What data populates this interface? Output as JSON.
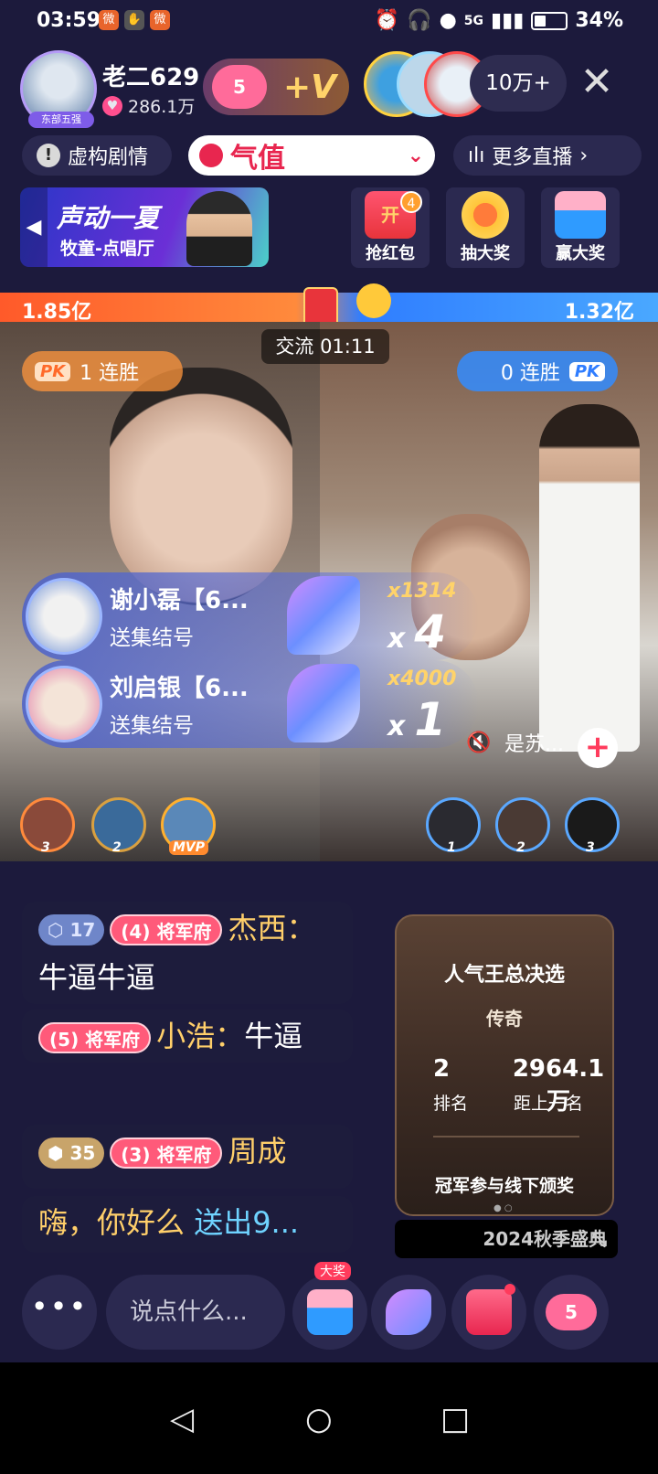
{
  "status_bar": {
    "time": "03:59",
    "battery": "34%",
    "network": "5G"
  },
  "host": {
    "name": "老二629",
    "fans": "286.1万",
    "level": "5",
    "follow_label": "+V",
    "avatar_tag": "东部五强"
  },
  "viewers": {
    "count": "10万+"
  },
  "chips": {
    "fiction": "虚构剧情",
    "search_text": "气值",
    "more_live": "更多直播"
  },
  "banner": {
    "title": "声动一夏",
    "subtitle": "牧童-点唱厅"
  },
  "activities": [
    {
      "label": "抢红包",
      "badge": "4",
      "icon_text": "开"
    },
    {
      "label": "抽大奖"
    },
    {
      "label": "赢大奖"
    }
  ],
  "pk": {
    "left_score": "1.85亿",
    "right_score": "1.32亿",
    "timer": "交流 01:11",
    "left_streak": "1 连胜",
    "right_streak": "0 连胜",
    "pk_icon": "PK"
  },
  "gift_toasts": [
    {
      "name": "谢小磊【6...",
      "action": "送集结号",
      "multiplier": "x1314",
      "count": "4",
      "x": "x"
    },
    {
      "name": "刘启银【6...",
      "action": "送集结号",
      "multiplier": "x4000",
      "count": "1",
      "x": "x"
    }
  ],
  "follow_other": {
    "name": "是苏..."
  },
  "ranks_left": [
    "3",
    "2",
    "MVP"
  ],
  "ranks_right": [
    "1",
    "2",
    "3"
  ],
  "comments": [
    {
      "gem": "17",
      "badge_level": "4",
      "badge_text": "将军府",
      "user": "杰西：",
      "text": "牛逼牛逼"
    },
    {
      "badge_level": "5",
      "badge_text": "将军府",
      "user": "小浩：",
      "text": "牛逼"
    },
    {
      "gem": "35",
      "badge_level": "3",
      "badge_text": "将军府",
      "user": "周成"
    },
    {
      "user": "嗨，你好么",
      "text": "送出9..."
    }
  ],
  "event_card": {
    "title": "人气王总决选",
    "tier": "传奇",
    "rank_value": "2",
    "rank_label": "排名",
    "gap_value": "2964.1万",
    "gap_label": "距上一名",
    "footer": "冠军参与线下颁奖",
    "event_name": "2024秋季盛典"
  },
  "bottom_bar": {
    "more": "•••",
    "input_placeholder": "说点什么...",
    "prize_badge": "大奖",
    "heart_level": "5"
  },
  "colors": {
    "background": "#1c1a3c",
    "pk_left": "#ff6a2a",
    "pk_right": "#2f7dff",
    "accent_gold": "#ffcf6a",
    "accent_pink": "#ff3b5c"
  }
}
